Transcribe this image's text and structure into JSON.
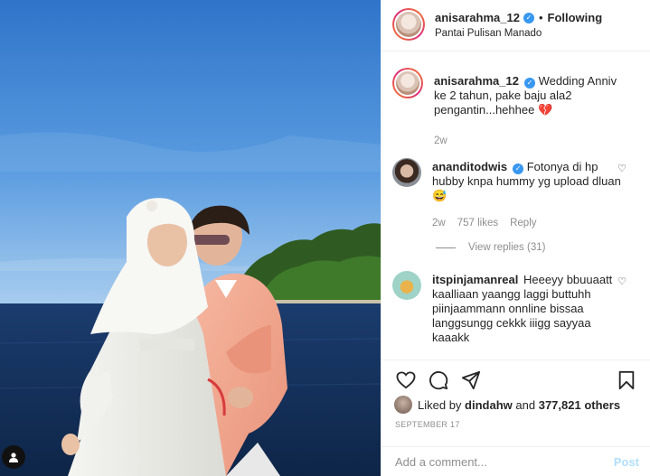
{
  "post": {
    "username": "anisarahma_12",
    "verified": true,
    "follow_status": "Following",
    "separator": "•",
    "location": "Pantai Pulisan Manado",
    "photo_icon": "user-tag-icon"
  },
  "caption": {
    "username": "anisarahma_12",
    "text": "Wedding Anniv ke 2 tahun, pake baju ala2 pengantin...hehhee",
    "emoji": "💔",
    "time": "2w"
  },
  "comments": [
    {
      "username": "ananditodwis",
      "verified": true,
      "text": "Fotonya di hp hubby knpa hummy yg upload dluan",
      "emoji": "😅",
      "time": "2w",
      "likes": "757 likes",
      "reply_label": "Reply",
      "view_replies": "View replies (31)"
    },
    {
      "username": "itspinjamanreal",
      "verified": false,
      "text": "Heeeyy bbuuaatt kaalliaan yaangg laggi buttuhh piinjaammann onnline bissaa langgsungg cekkk iiigg sayyaa kaaakk"
    }
  ],
  "actions": {
    "icons": [
      "heart-icon",
      "comment-icon",
      "share-icon",
      "bookmark-icon"
    ],
    "liked_by_prefix": "Liked by",
    "liked_by_user": "dindahw",
    "liked_by_and": "and",
    "liked_by_others": "377,821 others",
    "date": "SEPTEMBER 17"
  },
  "add_comment": {
    "placeholder": "Add a comment...",
    "post_label": "Post"
  },
  "colors": {
    "accent": "#3897f0",
    "post_disabled": "#b2dffc",
    "muted": "#8e8e8e",
    "text": "#262626"
  }
}
